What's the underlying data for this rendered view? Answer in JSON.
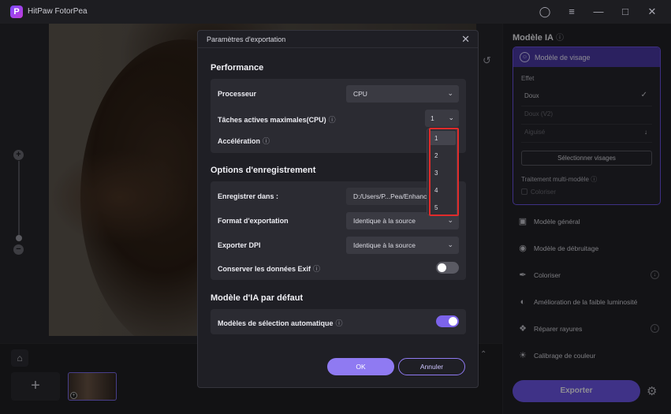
{
  "app": {
    "title": "HitPaw FotorPea",
    "logo_letter": "P"
  },
  "titlebar_icons": [
    "user-icon",
    "menu-icon",
    "minimize-icon",
    "maximize-icon",
    "close-icon"
  ],
  "right_panel": {
    "title": "Modèle IA",
    "face_model": {
      "label": "Modèle de visage",
      "effet_label": "Effet",
      "options": [
        {
          "label": "Doux",
          "selected": true
        },
        {
          "label": "Doux (V2)",
          "selected": false
        },
        {
          "label": "Aiguisé",
          "selected": false
        }
      ],
      "select_faces": "Sélectionner visages",
      "multi_label": "Traitement multi-modèle",
      "coloriser_check": "Coloriser"
    },
    "models": [
      {
        "label": "Modèle général",
        "icon": "image-icon",
        "download": false
      },
      {
        "label": "Modèle de débruitage",
        "icon": "denoise-icon",
        "download": false
      },
      {
        "label": "Coloriser",
        "icon": "colorize-icon",
        "download": true
      },
      {
        "label": "Amélioration de la faible luminosité",
        "icon": "low-light-icon",
        "download": false
      },
      {
        "label": "Réparer rayures",
        "icon": "scratch-repair-icon",
        "download": true
      },
      {
        "label": "Calibrage de couleur",
        "icon": "color-calibration-icon",
        "download": false
      }
    ],
    "export_label": "Exporter"
  },
  "modal": {
    "title": "Paramètres d'exportation",
    "performance": {
      "title": "Performance",
      "processor_label": "Processeur",
      "processor_value": "CPU",
      "tasks_label": "Tâches actives maximales(CPU)",
      "tasks_value": "1",
      "tasks_options": [
        "1",
        "2",
        "3",
        "4",
        "5"
      ],
      "acceleration_label": "Accélération"
    },
    "save_options": {
      "title": "Options d'enregistrement",
      "save_in_label": "Enregistrer dans :",
      "save_in_value": "D:/Users/P...Pea/Enhanced",
      "format_label": "Format d'exportation",
      "format_value": "Identique à la source",
      "dpi_label": "Exporter DPI",
      "dpi_value": "Identique à la source",
      "exif_label": "Conserver les données Exif",
      "exif_enabled": false
    },
    "default_ai": {
      "title": "Modèle d'IA par défaut",
      "auto_label": "Modèles de sélection automatique",
      "auto_enabled": true
    },
    "ok_label": "OK",
    "cancel_label": "Annuler"
  },
  "colors": {
    "accent": "#6d56e8",
    "highlight": "#e02b2b"
  }
}
